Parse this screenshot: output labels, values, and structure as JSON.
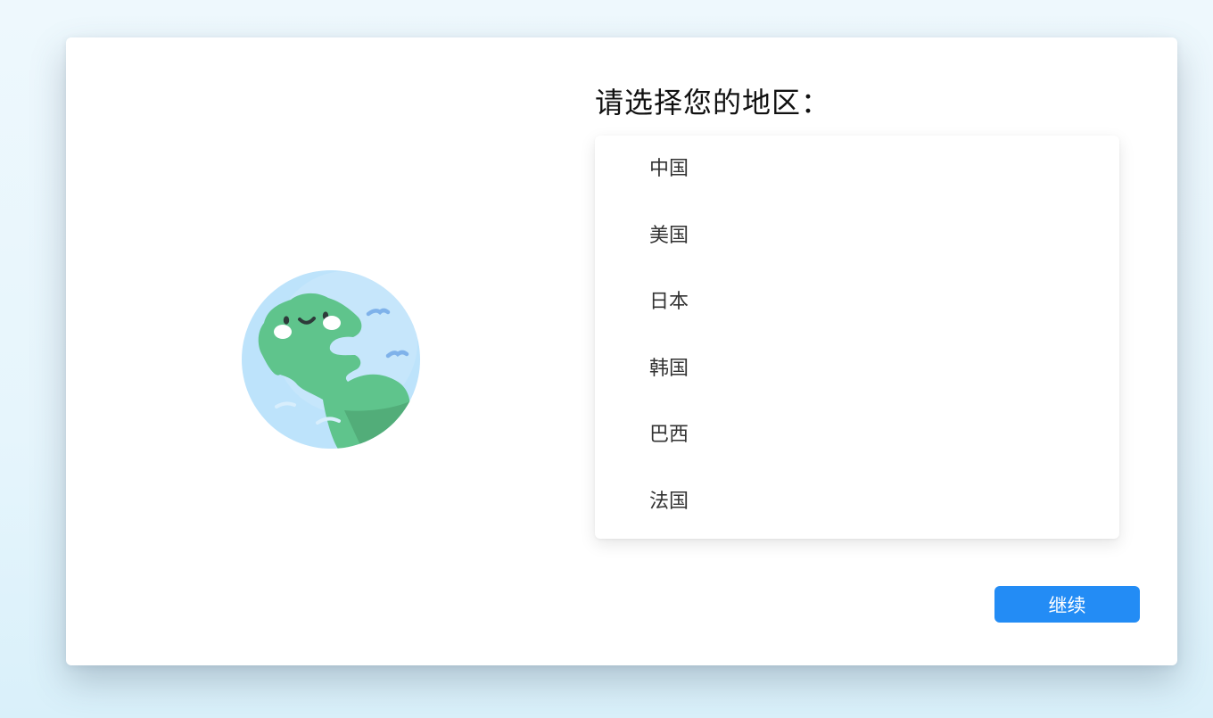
{
  "prompt": {
    "title": "请选择您的地区："
  },
  "regions": [
    {
      "label": "中国"
    },
    {
      "label": "美国"
    },
    {
      "label": "日本"
    },
    {
      "label": "韩国"
    },
    {
      "label": "巴西"
    },
    {
      "label": "法国"
    }
  ],
  "actions": {
    "continue_label": "继续"
  },
  "colors": {
    "accent": "#238cf5",
    "globe_ocean": "#bde3fb",
    "globe_land": "#5fc48c"
  },
  "icons": {
    "illustration": "smiling-globe-icon"
  }
}
